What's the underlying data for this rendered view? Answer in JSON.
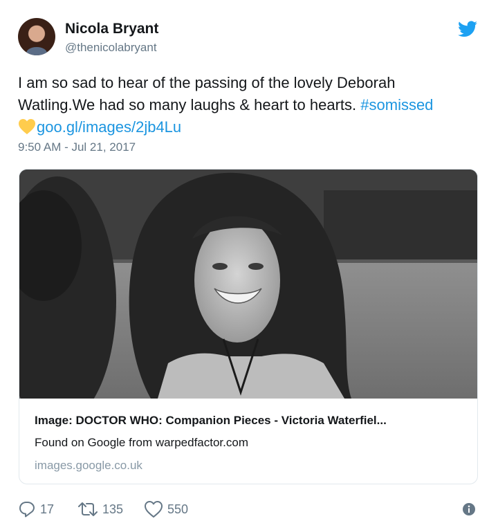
{
  "author": {
    "name": "Nicola Bryant",
    "handle": "@thenicolabryant"
  },
  "tweet": {
    "line1": "I am so sad to hear of the passing of the lovely Deborah",
    "line2_text": "Watling.We had so many laughs & heart to hearts. ",
    "hashtag": "#somissed",
    "link": "goo.gl/images/2jb4Lu",
    "timestamp": "9:50 AM - Jul 21, 2017"
  },
  "card": {
    "title": "Image: DOCTOR WHO: Companion Pieces - Victoria Waterfiel...",
    "description": "Found on Google from warpedfactor.com",
    "domain": "images.google.co.uk"
  },
  "actions": {
    "replies": "17",
    "retweets": "135",
    "likes": "550"
  },
  "colors": {
    "link": "#1b95e0",
    "secondary": "#657786",
    "twitter_blue": "#1da1f2",
    "heart_emoji": "#ffcc4d"
  },
  "icons": {
    "logo": "twitter-bird-icon",
    "reply": "reply-icon",
    "retweet": "retweet-icon",
    "like": "heart-icon",
    "info": "info-icon",
    "emoji": "yellow-heart-emoji"
  }
}
